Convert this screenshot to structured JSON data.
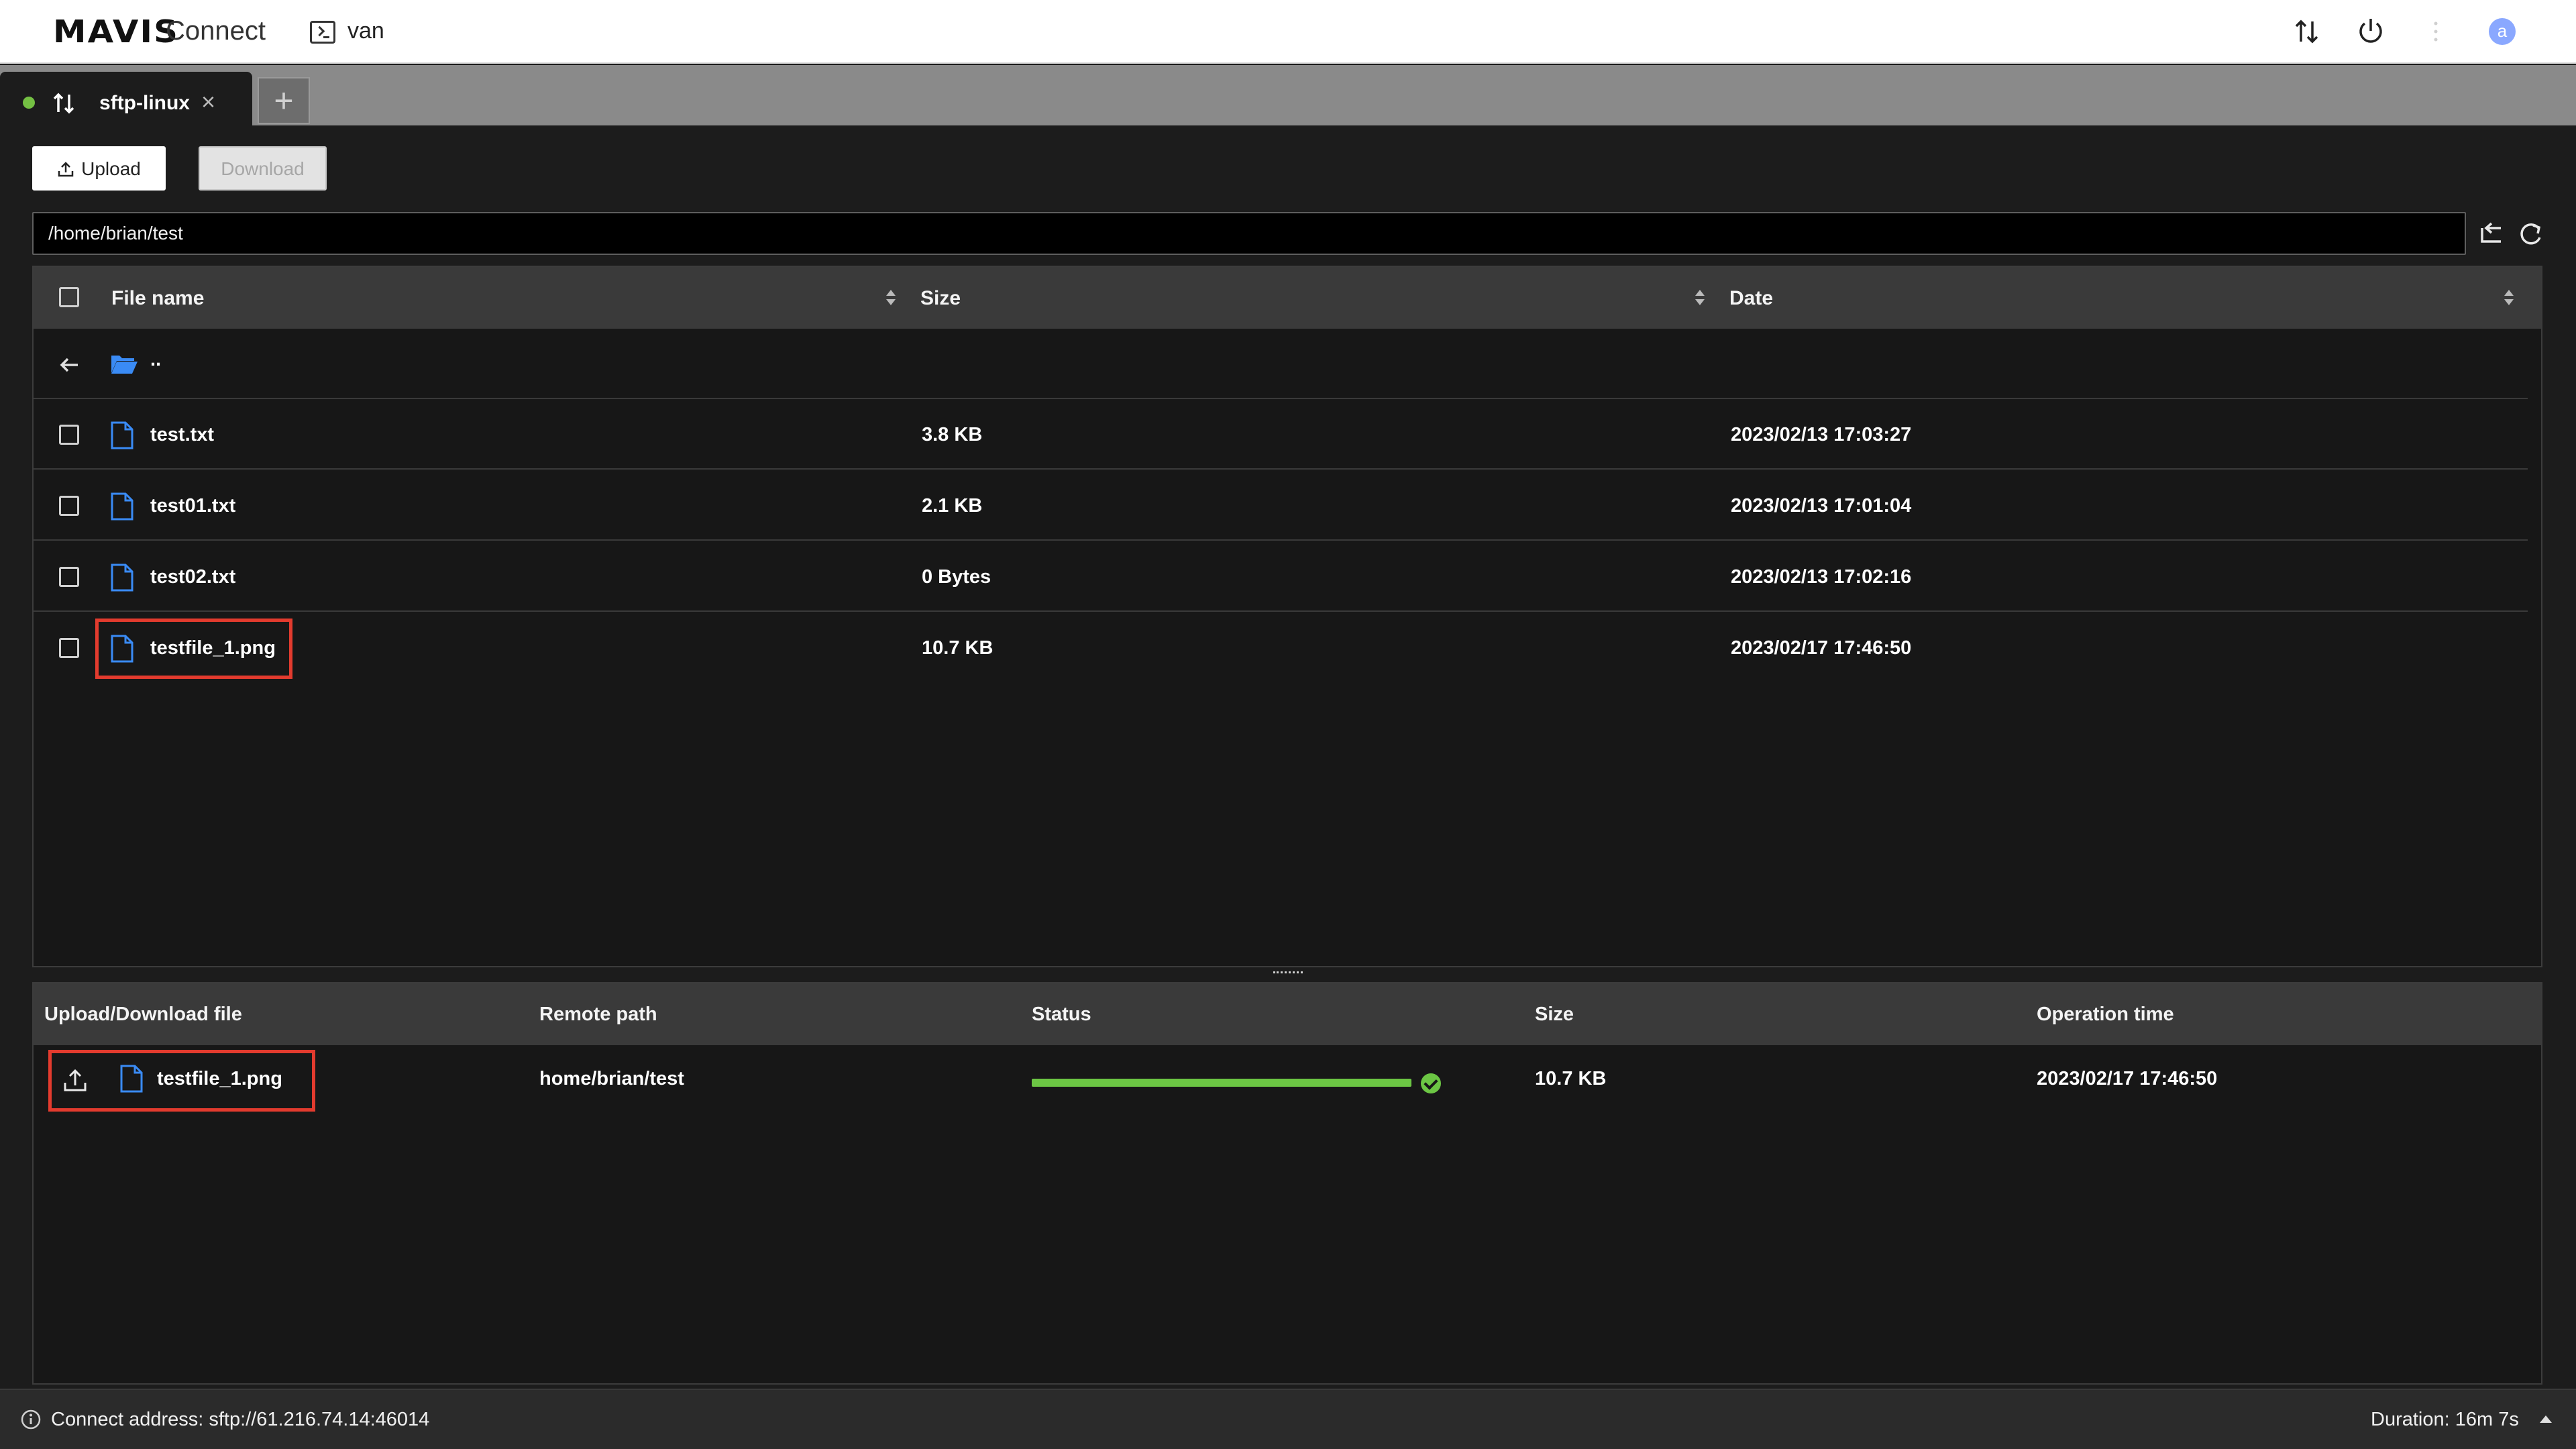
{
  "header": {
    "logo": "MAVIS",
    "product": "Connect",
    "host": "van",
    "avatar_letter": "a"
  },
  "tabs": {
    "active_label": "sftp-linux",
    "close_glyph": "×",
    "add_glyph": "+"
  },
  "toolbar": {
    "upload_label": "Upload",
    "download_label": "Download"
  },
  "path": "/home/brian/test",
  "file_table": {
    "headers": {
      "name": "File name",
      "size": "Size",
      "date": "Date"
    },
    "parent_label": "..",
    "rows": [
      {
        "name": "test.txt",
        "size": "3.8 KB",
        "date": "2023/02/13 17:03:27"
      },
      {
        "name": "test01.txt",
        "size": "2.1 KB",
        "date": "2023/02/13 17:01:04"
      },
      {
        "name": "test02.txt",
        "size": "0 Bytes",
        "date": "2023/02/13 17:02:16"
      },
      {
        "name": "testfile_1.png",
        "size": "10.7 KB",
        "date": "2023/02/17 17:46:50"
      }
    ]
  },
  "transfers": {
    "headers": {
      "file": "Upload/Download file",
      "remote": "Remote path",
      "status": "Status",
      "size": "Size",
      "time": "Operation time"
    },
    "rows": [
      {
        "file": "testfile_1.png",
        "remote": "home/brian/test",
        "progress": 1.0,
        "size": "10.7 KB",
        "time": "2023/02/17 17:46:50"
      }
    ]
  },
  "statusbar": {
    "address": "Connect address: sftp://61.216.74.14:46014",
    "duration": "Duration: 16m 7s"
  },
  "colors": {
    "highlight": "#e33b2e",
    "success": "#6cc644",
    "connected_dot": "#74c043",
    "file_icon": "#3a8bf5",
    "folder_icon": "#3a8bf5"
  }
}
